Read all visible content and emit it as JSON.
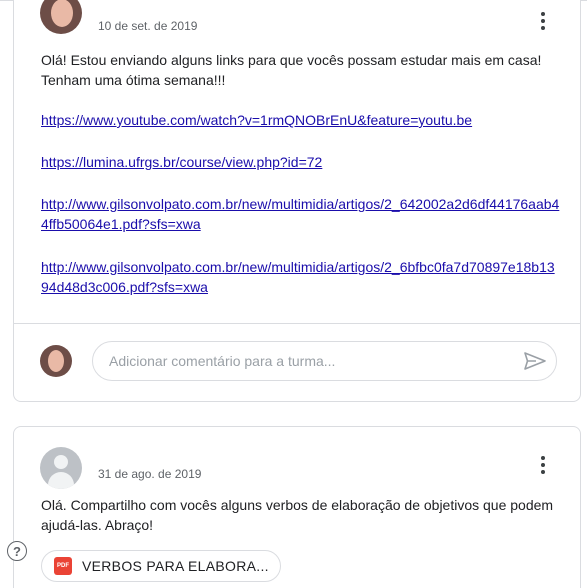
{
  "posts": [
    {
      "date": "10 de set. de 2019",
      "text": "Olá! Estou enviando alguns links para que vocês possam estudar mais em casa! Tenham uma ótima semana!!!",
      "links": [
        "https://www.youtube.com/watch?v=1rmQNOBrEnU&feature=youtu.be",
        "https://lumina.ufrgs.br/course/view.php?id=72",
        "http://www.gilsonvolpato.com.br/new/multimidia/artigos/2_642002a2d6df44176aab44ffb50064e1.pdf?sfs=xwa",
        "http://www.gilsonvolpato.com.br/new/multimidia/artigos/2_6bfbc0fa7d70897e18b1394d48d3c006.pdf?sfs=xwa"
      ],
      "comment_placeholder": "Adicionar comentário para a turma..."
    },
    {
      "date": "31 de ago. de 2019",
      "text": "Olá. Compartilho com vocês alguns verbos de elaboração de objetivos que podem ajudá-las. Abraço!",
      "attachment": {
        "type_label": "PDF",
        "name": "VERBOS PARA ELABORA..."
      }
    }
  ],
  "help": {
    "label": "?"
  },
  "colors": {
    "link": "#1a0dab",
    "border": "#dadce0",
    "pdf": "#ea4335"
  },
  "icons": [
    "kebab-menu-icon",
    "send-icon",
    "pdf-icon",
    "help-icon",
    "avatar-generic-icon"
  ]
}
